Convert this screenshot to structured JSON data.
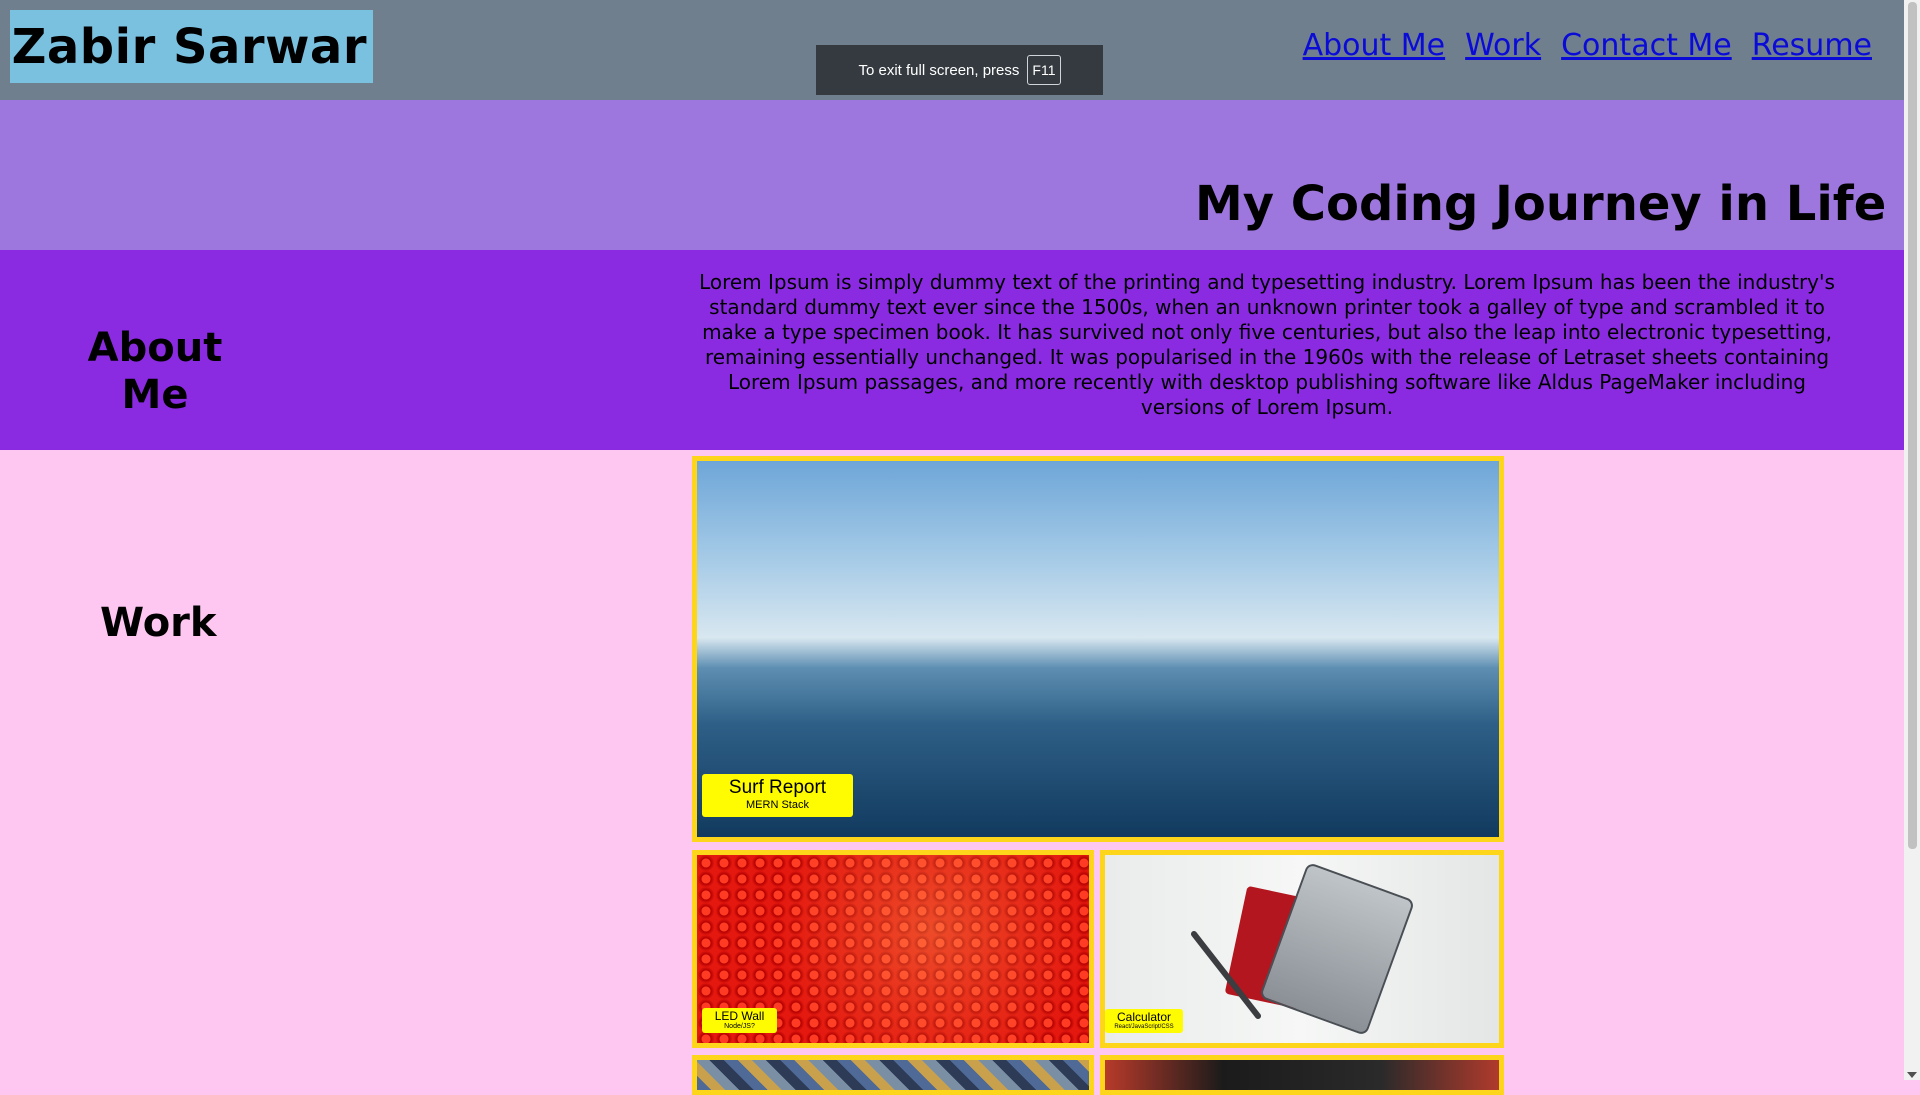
{
  "header": {
    "brand": "Zabir Sarwar",
    "nav": [
      "About Me",
      "Work",
      "Contact Me",
      "Resume"
    ]
  },
  "fullscreen_notice": {
    "text": "To exit full screen, press",
    "key": "F11"
  },
  "hero": {
    "title": "My Coding Journey in Life"
  },
  "about": {
    "heading": "About Me",
    "body": "Lorem Ipsum is simply dummy text of the printing and typesetting industry. Lorem Ipsum has been the industry's standard dummy text ever since the 1500s, when an unknown printer took a galley of type and scrambled it to make a type specimen book. It has survived not only five centuries, but also the leap into electronic typesetting, remaining essentially unchanged. It was popularised in the 1960s with the release of Letraset sheets containing Lorem Ipsum passages, and more recently with desktop publishing software like Aldus PageMaker including versions of Lorem Ipsum."
  },
  "work": {
    "heading": "Work",
    "projects": [
      {
        "title": "Surf Report",
        "stack": "MERN Stack"
      },
      {
        "title": "LED Wall",
        "stack": "Node/JS?"
      },
      {
        "title": "Calculator",
        "stack": "React/JavaScript/CSS"
      }
    ]
  },
  "colors": {
    "header_bg": "#6f7f8e",
    "brand_bg": "#7ac1df",
    "hero_bg": "#9d77de",
    "about_bg": "#8a2be2",
    "work_bg": "#fdc7f2",
    "tile_border": "#fdd51a",
    "link": "#0b0bd8"
  }
}
